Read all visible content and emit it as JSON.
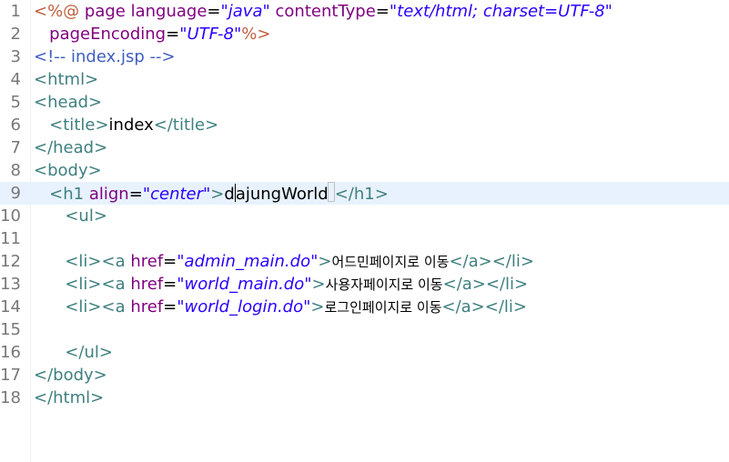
{
  "editor": {
    "file_comment": "<!-- index.jsp -->",
    "lines": [
      {
        "n": "1",
        "parts": [
          {
            "c": "dir",
            "t": "<%@ "
          },
          {
            "c": "attr",
            "t": "page language"
          },
          {
            "c": "txt",
            "t": "="
          },
          {
            "c": "val",
            "t": "\"java\""
          },
          {
            "c": "txt",
            "t": " "
          },
          {
            "c": "attr",
            "t": "contentType"
          },
          {
            "c": "txt",
            "t": "="
          },
          {
            "c": "val",
            "t": "\"text/html; charset=UTF-8\""
          }
        ]
      },
      {
        "n": "2",
        "parts": [
          {
            "c": "txt",
            "t": "   "
          },
          {
            "c": "attr",
            "t": "pageEncoding"
          },
          {
            "c": "txt",
            "t": "="
          },
          {
            "c": "val",
            "t": "\"UTF-8\""
          },
          {
            "c": "dir",
            "t": "%>"
          }
        ]
      },
      {
        "n": "3",
        "parts": [
          {
            "c": "cmt",
            "t": "<!-- index.jsp -->"
          }
        ]
      },
      {
        "n": "4",
        "parts": [
          {
            "c": "tag",
            "t": "<html>"
          }
        ]
      },
      {
        "n": "5",
        "parts": [
          {
            "c": "tag",
            "t": "<head>"
          }
        ]
      },
      {
        "n": "6",
        "parts": [
          {
            "c": "txt",
            "t": "   "
          },
          {
            "c": "tag",
            "t": "<title>"
          },
          {
            "c": "txt",
            "t": "index"
          },
          {
            "c": "tag",
            "t": "</title>"
          }
        ]
      },
      {
        "n": "7",
        "parts": [
          {
            "c": "tag",
            "t": "</head>"
          }
        ]
      },
      {
        "n": "8",
        "parts": [
          {
            "c": "tag",
            "t": "<body>"
          }
        ]
      },
      {
        "n": "9",
        "current": true,
        "parts": [
          {
            "c": "txt",
            "t": "   "
          },
          {
            "c": "tag",
            "t": "<h1 "
          },
          {
            "c": "attr",
            "t": "align"
          },
          {
            "c": "txt",
            "t": "="
          },
          {
            "c": "val",
            "t": "\"center\""
          },
          {
            "c": "tag",
            "t": ">"
          },
          {
            "c": "txt",
            "t": "d"
          },
          {
            "c": "caret",
            "t": ""
          },
          {
            "c": "txt",
            "t": "ajungWorld"
          },
          {
            "c": "box",
            "t": ""
          },
          {
            "c": "tag",
            "t": "</h1>"
          }
        ]
      },
      {
        "n": "10",
        "parts": [
          {
            "c": "txt",
            "t": "      "
          },
          {
            "c": "tag",
            "t": "<ul>"
          }
        ]
      },
      {
        "n": "11",
        "parts": []
      },
      {
        "n": "12",
        "parts": [
          {
            "c": "txt",
            "t": "      "
          },
          {
            "c": "tag",
            "t": "<li><a "
          },
          {
            "c": "attr",
            "t": "href"
          },
          {
            "c": "txt",
            "t": "="
          },
          {
            "c": "val",
            "t": "\"admin_main.do\""
          },
          {
            "c": "tag",
            "t": ">"
          },
          {
            "c": "kr",
            "t": "어드민페이지로 이동"
          },
          {
            "c": "tag",
            "t": "</a></li>"
          }
        ]
      },
      {
        "n": "13",
        "parts": [
          {
            "c": "txt",
            "t": "      "
          },
          {
            "c": "tag",
            "t": "<li><a "
          },
          {
            "c": "attr",
            "t": "href"
          },
          {
            "c": "txt",
            "t": "="
          },
          {
            "c": "val",
            "t": "\"world_main.do\""
          },
          {
            "c": "tag",
            "t": ">"
          },
          {
            "c": "kr",
            "t": "사용자페이지로 이동"
          },
          {
            "c": "tag",
            "t": "</a></li>"
          }
        ]
      },
      {
        "n": "14",
        "parts": [
          {
            "c": "txt",
            "t": "      "
          },
          {
            "c": "tag",
            "t": "<li><a "
          },
          {
            "c": "attr",
            "t": "href"
          },
          {
            "c": "txt",
            "t": "="
          },
          {
            "c": "val",
            "t": "\"world_login.do\""
          },
          {
            "c": "tag",
            "t": ">"
          },
          {
            "c": "kr",
            "t": "로그인페이지로 이동"
          },
          {
            "c": "tag",
            "t": "</a></li>"
          }
        ]
      },
      {
        "n": "15",
        "parts": []
      },
      {
        "n": "16",
        "parts": [
          {
            "c": "txt",
            "t": "      "
          },
          {
            "c": "tag",
            "t": "</ul>"
          }
        ]
      },
      {
        "n": "17",
        "parts": [
          {
            "c": "tag",
            "t": "</body>"
          }
        ]
      },
      {
        "n": "18",
        "parts": [
          {
            "c": "tag",
            "t": "</html>"
          }
        ]
      }
    ]
  },
  "colors": {
    "tag": "#3f7f7f",
    "attribute": "#7f007f",
    "value": "#2a00ff",
    "directive": "#bf5f3f",
    "comment": "#3f5fbf",
    "current_line_bg": "#e8f2fe",
    "line_number": "#787878"
  }
}
